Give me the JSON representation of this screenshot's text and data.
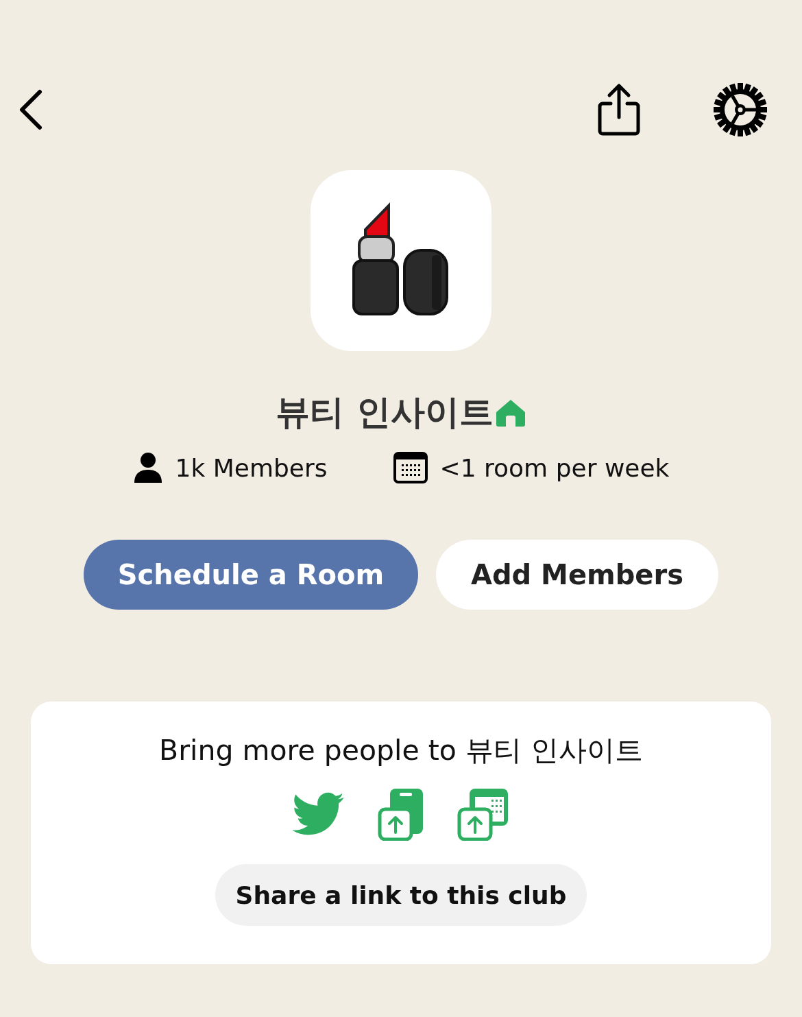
{
  "club": {
    "name": "뷰티 인사이트",
    "members": "1k Members",
    "frequency": "<1 room per week"
  },
  "buttons": [
    {
      "label": "Schedule a Room",
      "kind": "primary"
    },
    {
      "label": "Add Members",
      "kind": "secondary"
    }
  ],
  "invite_card": {
    "title": "Bring more people to 뷰티 인사이트",
    "share_button": "Share a link to this club"
  }
}
